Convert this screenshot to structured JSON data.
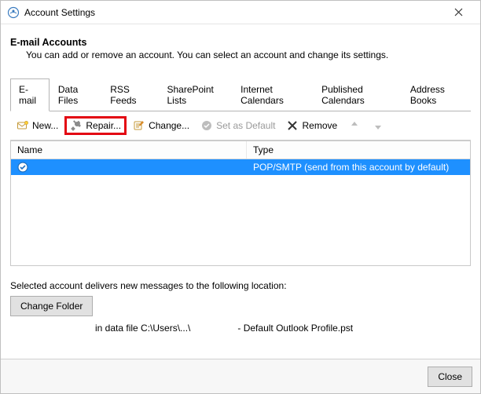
{
  "window": {
    "title": "Account Settings"
  },
  "header": {
    "title": "E-mail Accounts",
    "subtitle": "You can add or remove an account. You can select an account and change its settings."
  },
  "tabs": [
    {
      "label": "E-mail",
      "active": true
    },
    {
      "label": "Data Files"
    },
    {
      "label": "RSS Feeds"
    },
    {
      "label": "SharePoint Lists"
    },
    {
      "label": "Internet Calendars"
    },
    {
      "label": "Published Calendars"
    },
    {
      "label": "Address Books"
    }
  ],
  "toolbar": {
    "new": "New...",
    "repair": "Repair...",
    "change": "Change...",
    "set_default": "Set as Default",
    "remove": "Remove"
  },
  "table": {
    "headers": {
      "name": "Name",
      "type": "Type"
    },
    "rows": [
      {
        "name": "",
        "type": "POP/SMTP (send from this account by default)",
        "default": true,
        "selected": true
      }
    ]
  },
  "delivery": {
    "label": "Selected account delivers new messages to the following location:",
    "change_folder": "Change Folder",
    "path_prefix": "in data file C:\\Users\\...\\",
    "path_suffix": "- Default Outlook Profile.pst"
  },
  "footer": {
    "close": "Close"
  }
}
